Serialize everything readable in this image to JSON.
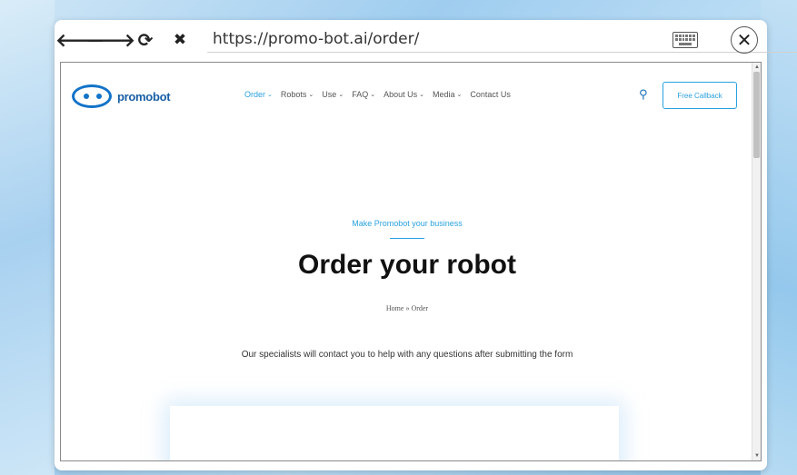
{
  "browser": {
    "url": "https://promo-bot.ai/order/",
    "back_glyph": "🡐",
    "forward_glyph": "🡒",
    "reload_glyph": "⟳",
    "stop_glyph": "✖",
    "close_glyph": "✕",
    "icons": [
      "back-arrow-icon",
      "forward-arrow-icon",
      "reload-icon",
      "stop-icon",
      "keyboard-icon",
      "close-icon"
    ]
  },
  "site": {
    "logo_text": "promobot",
    "nav": [
      {
        "label": "Order",
        "active": true
      },
      {
        "label": "Robots"
      },
      {
        "label": "Use"
      },
      {
        "label": "FAQ"
      },
      {
        "label": "About Us"
      },
      {
        "label": "Media"
      },
      {
        "label": "Contact Us"
      }
    ],
    "chevron": "⌄",
    "search_glyph": "⚲",
    "callback_label": "Free Callback"
  },
  "hero": {
    "eyebrow": "Make Promobot your business",
    "title": "Order your robot",
    "breadcrumb": "Home » Order",
    "intro": "Our specialists will contact you to help with any questions after submitting the form"
  },
  "form": {
    "select_value": "—",
    "select_chevron": "⌄"
  },
  "colors": {
    "accent": "#2aa1e0",
    "brand": "#1273c8"
  }
}
